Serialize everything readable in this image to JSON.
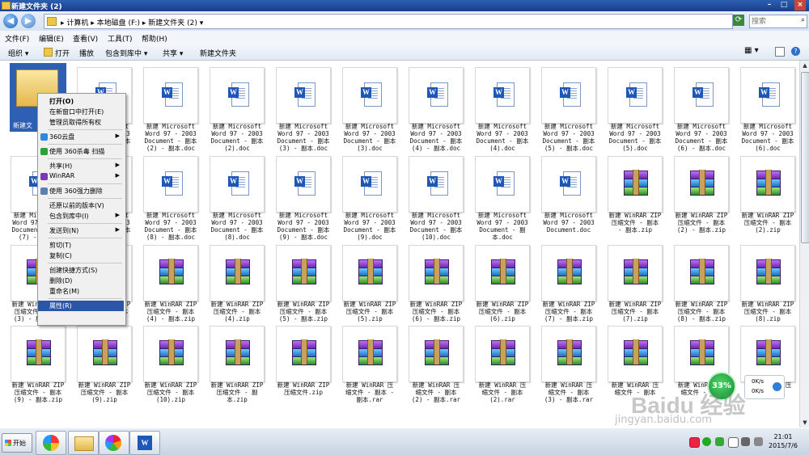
{
  "window": {
    "title": "新建文件夹 (2)"
  },
  "address": {
    "crumbs": "▸ 计算机 ▸ 本地磁盘 (F:) ▸ 新建文件夹 (2) ▾",
    "search_placeholder": "搜索"
  },
  "menu": [
    "文件(F)",
    "编辑(E)",
    "查看(V)",
    "工具(T)",
    "帮助(H)"
  ],
  "toolbar": {
    "organize": "组织 ▾",
    "open": "打开",
    "play": "播放",
    "include_lib": "包含到库中 ▾",
    "share": "共享 ▾",
    "new_folder": "新建文件夹"
  },
  "selected_folder_label": "新建文",
  "context_menu": [
    {
      "label": "打开(O)",
      "bold": true
    },
    {
      "label": "在新窗口中打开(E)"
    },
    {
      "label": "管理员取得所有权"
    },
    {
      "sep": true
    },
    {
      "label": "360云盘",
      "arrow": true,
      "icon": "cloud-icon"
    },
    {
      "sep": true
    },
    {
      "label": "使用 360杀毒 扫描",
      "icon": "shield-icon"
    },
    {
      "sep": true
    },
    {
      "label": "共享(H)",
      "arrow": true
    },
    {
      "label": "WinRAR",
      "arrow": true,
      "icon": "winrar-icon"
    },
    {
      "sep": true
    },
    {
      "label": "使用 360强力删除",
      "icon": "trash-icon"
    },
    {
      "sep": true
    },
    {
      "label": "还原以前的版本(V)"
    },
    {
      "label": "包含到库中(I)",
      "arrow": true
    },
    {
      "sep": true
    },
    {
      "label": "发送到(N)",
      "arrow": true
    },
    {
      "sep": true
    },
    {
      "label": "剪切(T)"
    },
    {
      "label": "复制(C)"
    },
    {
      "sep": true
    },
    {
      "label": "创建快捷方式(S)"
    },
    {
      "label": "删除(D)"
    },
    {
      "label": "重命名(M)"
    },
    {
      "sep": true
    },
    {
      "label": "属性(R)",
      "highlight": true
    }
  ],
  "rows": [
    [
      null,
      {
        "type": "word",
        "name": "新建 Microsoft\nWord 97 - 2003\nDocument - 副本 (2)..."
      },
      {
        "type": "word",
        "name": "新建 Microsoft\nWord 97 - 2003\nDocument - 副本\n(2) - 副本.doc"
      },
      {
        "type": "word",
        "name": "新建 Microsoft\nWord 97 - 2003\nDocument - 副本\n(2).doc"
      },
      {
        "type": "word",
        "name": "新建 Microsoft\nWord 97 - 2003\nDocument - 副本\n(3) - 副本.doc"
      },
      {
        "type": "word",
        "name": "新建 Microsoft\nWord 97 - 2003\nDocument - 副本\n(3).doc"
      },
      {
        "type": "word",
        "name": "新建 Microsoft\nWord 97 - 2003\nDocument - 副本\n(4) - 副本.doc"
      },
      {
        "type": "word",
        "name": "新建 Microsoft\nWord 97 - 2003\nDocument - 副本\n(4).doc"
      },
      {
        "type": "word",
        "name": "新建 Microsoft\nWord 97 - 2003\nDocument - 副本\n(5) - 副本.doc"
      },
      {
        "type": "word",
        "name": "新建 Microsoft\nWord 97 - 2003\nDocument - 副本\n(5).doc"
      },
      {
        "type": "word",
        "name": "新建 Microsoft\nWord 97 - 2003\nDocument - 副本\n(6) - 副本.doc"
      },
      {
        "type": "word",
        "name": "新建 Microsoft\nWord 97 - 2003\nDocument - 副本\n(6).doc"
      }
    ],
    [
      {
        "type": "word",
        "name": "新建 Microsoft\nWord 97 - 2003\nDocument - 副本\n(7) - 副..."
      },
      {
        "type": "word",
        "name": "新建 Microsoft\nWord 97 - 2003\nDocument - 副本\n(7).doc"
      },
      {
        "type": "word",
        "name": "新建 Microsoft\nWord 97 - 2003\nDocument - 副本\n(8) - 副本.doc"
      },
      {
        "type": "word",
        "name": "新建 Microsoft\nWord 97 - 2003\nDocument - 副本\n(8).doc"
      },
      {
        "type": "word",
        "name": "新建 Microsoft\nWord 97 - 2003\nDocument - 副本\n(9) - 副本.doc"
      },
      {
        "type": "word",
        "name": "新建 Microsoft\nWord 97 - 2003\nDocument - 副本\n(9).doc"
      },
      {
        "type": "word",
        "name": "新建 Microsoft\nWord 97 - 2003\nDocument - 副本\n(10).doc"
      },
      {
        "type": "word",
        "name": "新建 Microsoft\nWord 97 - 2003\nDocument - 副\n本.doc"
      },
      {
        "type": "word",
        "name": "新建 Microsoft\nWord 97 - 2003\nDocument.doc"
      },
      {
        "type": "rar",
        "name": "新建 WinRAR ZIP\n压缩文件 - 副本\n- 副本.zip"
      },
      {
        "type": "rar",
        "name": "新建 WinRAR ZIP\n压缩文件 - 副本\n(2) - 副本.zip"
      },
      {
        "type": "rar",
        "name": "新建 WinRAR ZIP\n压缩文件 - 副本\n(2).zip"
      }
    ],
    [
      {
        "type": "rar",
        "name": "新建 WinRAR ZIP\n压缩文件 - 副本\n(3) - 副本.zip"
      },
      {
        "type": "rar",
        "name": "新建 WinRAR ZIP\n压缩文件 - 副本\n(3).zip"
      },
      {
        "type": "rar",
        "name": "新建 WinRAR ZIP\n压缩文件 - 副本\n(4) - 副本.zip"
      },
      {
        "type": "rar",
        "name": "新建 WinRAR ZIP\n压缩文件 - 副本\n(4).zip"
      },
      {
        "type": "rar",
        "name": "新建 WinRAR ZIP\n压缩文件 - 副本\n(5) - 副本.zip"
      },
      {
        "type": "rar",
        "name": "新建 WinRAR ZIP\n压缩文件 - 副本\n(5).zip"
      },
      {
        "type": "rar",
        "name": "新建 WinRAR ZIP\n压缩文件 - 副本\n(6) - 副本.zip"
      },
      {
        "type": "rar",
        "name": "新建 WinRAR ZIP\n压缩文件 - 副本\n(6).zip"
      },
      {
        "type": "rar",
        "name": "新建 WinRAR ZIP\n压缩文件 - 副本\n(7) - 副本.zip"
      },
      {
        "type": "rar",
        "name": "新建 WinRAR ZIP\n压缩文件 - 副本\n(7).zip"
      },
      {
        "type": "rar",
        "name": "新建 WinRAR ZIP\n压缩文件 - 副本\n(8) - 副本.zip"
      },
      {
        "type": "rar",
        "name": "新建 WinRAR ZIP\n压缩文件 - 副本\n(8).zip"
      }
    ],
    [
      {
        "type": "rar",
        "name": "新建 WinRAR ZIP\n压缩文件 - 副本\n(9) - 副本.zip"
      },
      {
        "type": "rar",
        "name": "新建 WinRAR ZIP\n压缩文件 - 副本\n(9).zip"
      },
      {
        "type": "rar",
        "name": "新建 WinRAR ZIP\n压缩文件 - 副本\n(10).zip"
      },
      {
        "type": "rar",
        "name": "新建 WinRAR ZIP\n压缩文件 - 副\n本.zip"
      },
      {
        "type": "rar",
        "name": "新建 WinRAR ZIP\n压缩文件.zip"
      },
      {
        "type": "rar",
        "name": "新建 WinRAR 压\n缩文件 - 副本 -\n副本.rar"
      },
      {
        "type": "rar",
        "name": "新建 WinRAR 压\n缩文件 - 副本\n(2) - 副本.rar"
      },
      {
        "type": "rar",
        "name": "新建 WinRAR 压\n缩文件 - 副本\n(2).rar"
      },
      {
        "type": "rar",
        "name": "新建 WinRAR 压\n缩文件 - 副本\n(3) - 副本.rar"
      },
      {
        "type": "rar",
        "name": "新建 WinRAR 压\n缩文件 - 副本"
      },
      {
        "type": "rar",
        "name": "新建 WinRAR 压\n缩文件 - 副本"
      },
      {
        "type": "rar",
        "name": "新建 WinRAR 压\n缩文件"
      }
    ]
  ],
  "float360": {
    "percent": "33%"
  },
  "net": {
    "up": "0K/s",
    "down": "0K/s"
  },
  "clock": {
    "time": "21:01",
    "date": "2015/7/6"
  },
  "taskbar": {
    "start_label": "开始"
  },
  "watermark": {
    "logo": "Baidu 经验",
    "url": "jingyan.baidu.com"
  },
  "colors": {
    "title_bar": "#1b3f8a",
    "selection": "#2f5fb3",
    "menu_highlight": "#2b56a8"
  }
}
